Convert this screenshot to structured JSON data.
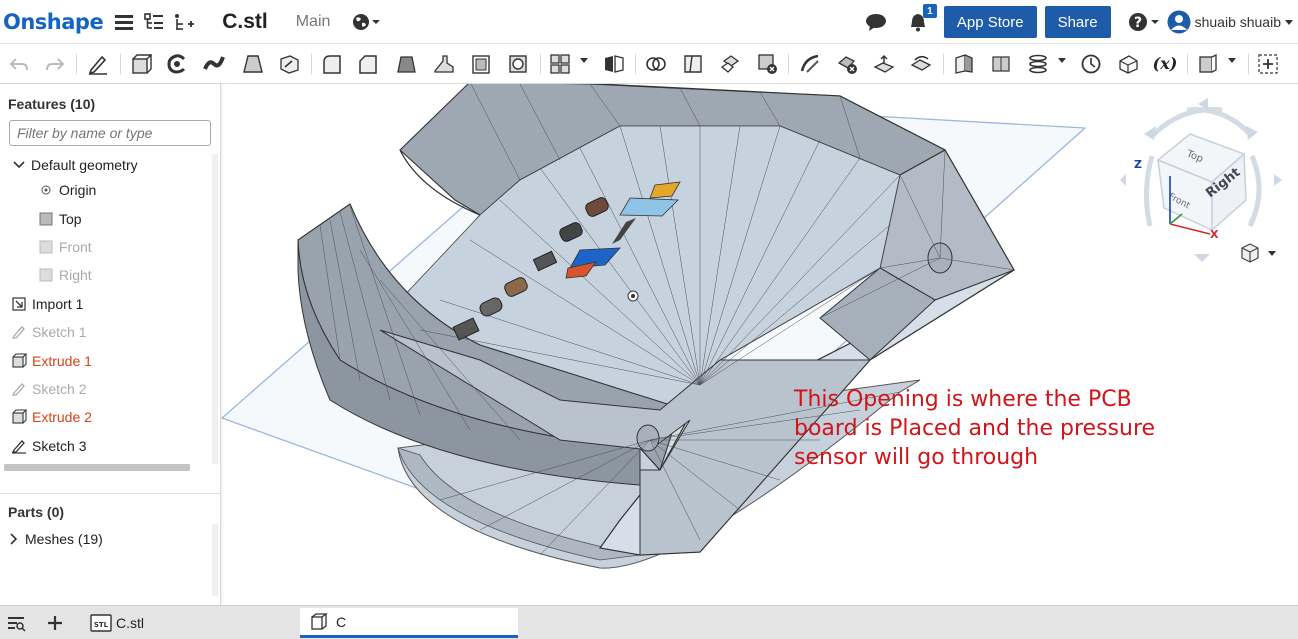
{
  "header": {
    "logo": "Onshape",
    "doc_title": "C.stl",
    "workspace": "Main",
    "notification_count": "1",
    "app_store_label": "App Store",
    "share_label": "Share",
    "user_name": "shuaib shuaib"
  },
  "features": {
    "title": "Features (10)",
    "filter_placeholder": "Filter by name or type",
    "items": [
      {
        "label": "Default geometry"
      },
      {
        "label": "Origin"
      },
      {
        "label": "Top"
      },
      {
        "label": "Front"
      },
      {
        "label": "Right"
      },
      {
        "label": "Import 1"
      },
      {
        "label": "Sketch 1"
      },
      {
        "label": "Extrude 1"
      },
      {
        "label": "Sketch 2"
      },
      {
        "label": "Extrude 2"
      },
      {
        "label": "Sketch 3"
      }
    ]
  },
  "parts": {
    "title": "Parts (0)",
    "meshes_label": "Meshes (19)"
  },
  "tabs": [
    {
      "label": "C.stl"
    },
    {
      "label": "C"
    }
  ],
  "viewcube": {
    "face_right": "Right",
    "face_top": "Top",
    "face_front": "Front",
    "axis_z": "Z",
    "axis_x": "X"
  },
  "annotation": {
    "line1": "This Opening is where the PCB",
    "line2": "board is Placed and the pressure",
    "line3": "sensor will go through"
  },
  "colors": {
    "brand": "#1565c0",
    "button": "#1e5ba8",
    "error_feature": "#d84315",
    "annotation": "#d0141a",
    "model": "#c9d3de"
  }
}
